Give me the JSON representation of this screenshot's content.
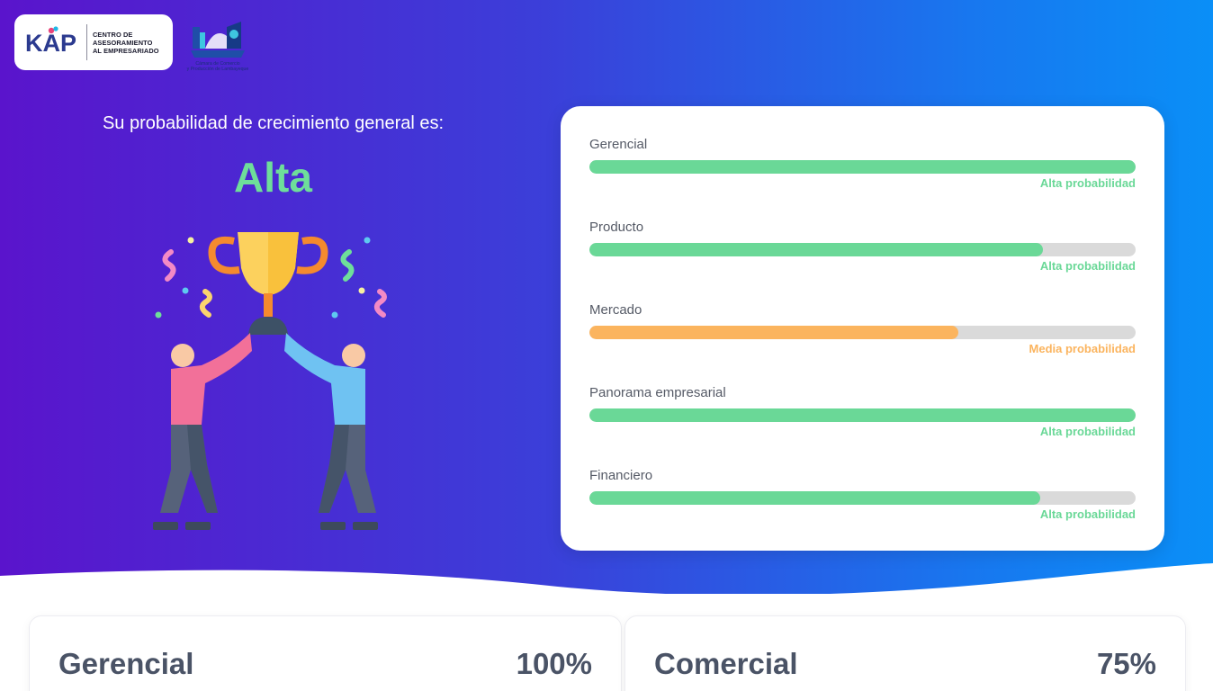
{
  "header": {
    "logo_wordmark": "KAP",
    "logo_lines": [
      "CENTRO DE",
      "ASESORAMIENTO",
      "AL EMPRESARIADO"
    ],
    "partner_logo_text": "Cámara de Comercio y Producción de Lambayeque"
  },
  "hero": {
    "headline": "Su probabilidad de crecimiento general es:",
    "level": "Alta",
    "level_color": "#6ede9a"
  },
  "metrics": [
    {
      "label": "Gerencial",
      "progress": 1.0,
      "status": "Alta probabilidad",
      "color": "#6ad897"
    },
    {
      "label": "Producto",
      "progress": 0.83,
      "status": "Alta probabilidad",
      "color": "#6ad897"
    },
    {
      "label": "Mercado",
      "progress": 0.675,
      "status": "Media probabilidad",
      "color": "#fbb45e"
    },
    {
      "label": "Panorama empresarial",
      "progress": 1.0,
      "status": "Alta probabilidad",
      "color": "#6ad897"
    },
    {
      "label": "Financiero",
      "progress": 0.825,
      "status": "Alta probabilidad",
      "color": "#6ad897"
    }
  ],
  "cards": [
    {
      "title": "Gerencial",
      "value": "100%"
    },
    {
      "title": "Comercial",
      "value": "75%"
    }
  ]
}
